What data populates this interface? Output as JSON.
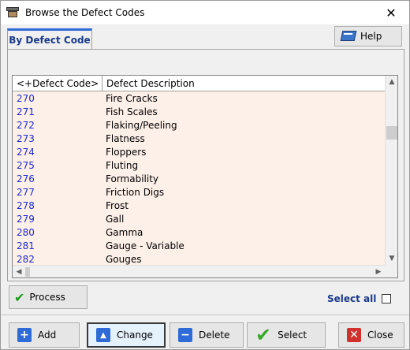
{
  "window": {
    "title": "Browse the Defect Codes",
    "close_glyph": "✕"
  },
  "tabs": [
    {
      "label": "By Defect Code",
      "active": true
    }
  ],
  "help_button": {
    "label": "Help",
    "icon": "book-icon"
  },
  "grid": {
    "columns": [
      "<+Defect Code>",
      "Defect Description"
    ],
    "rows": [
      {
        "code": "270",
        "desc": "Fire Cracks"
      },
      {
        "code": "271",
        "desc": "Fish Scales"
      },
      {
        "code": "272",
        "desc": "Flaking/Peeling"
      },
      {
        "code": "273",
        "desc": "Flatness"
      },
      {
        "code": "274",
        "desc": "Floppers"
      },
      {
        "code": "275",
        "desc": "Fluting"
      },
      {
        "code": "276",
        "desc": "Formability"
      },
      {
        "code": "277",
        "desc": "Friction Digs"
      },
      {
        "code": "278",
        "desc": "Frost"
      },
      {
        "code": "279",
        "desc": "Gall"
      },
      {
        "code": "280",
        "desc": "Gamma"
      },
      {
        "code": "281",
        "desc": "Gauge - Variable"
      },
      {
        "code": "282",
        "desc": "Gouges"
      }
    ],
    "row_bg": "#fdf0e8",
    "code_color": "#1e2ad0"
  },
  "process_button": {
    "label": "Process",
    "icon": "checkmark-icon"
  },
  "select_all": {
    "label": "Select all",
    "checked": false
  },
  "bottom_buttons": {
    "add": {
      "label": "Add",
      "icon": "plus-icon"
    },
    "change": {
      "label": "Change",
      "icon": "up-triangle-icon"
    },
    "delete": {
      "label": "Delete",
      "icon": "minus-icon"
    },
    "select": {
      "label": "Select",
      "icon": "checkmark-icon"
    },
    "close": {
      "label": "Close",
      "icon": "close-x-icon"
    }
  }
}
